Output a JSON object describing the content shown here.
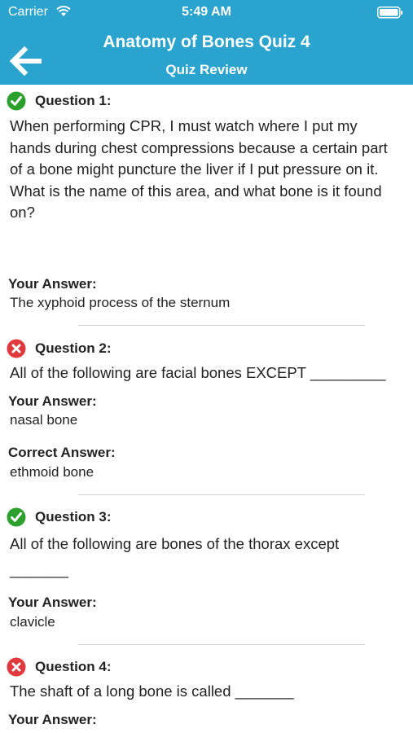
{
  "status_bar": {
    "carrier": "Carrier",
    "time": "5:49 AM"
  },
  "header": {
    "title": "Anatomy of Bones Quiz 4",
    "subtitle": "Quiz Review",
    "color": "#2aa3cf"
  },
  "colors": {
    "correct": "#2ca02c",
    "incorrect": "#e0393e"
  },
  "questions": [
    {
      "label": "Question 1:",
      "status": "correct",
      "text": "When performing CPR, I must watch where I put my hands during chest compressions because a certain part of a bone might puncture the liver if I put pressure on it. What is the name of this area, and what bone is it found on?",
      "your_answer_label": "Your Answer:",
      "your_answer": "The xyphoid process of the sternum"
    },
    {
      "label": "Question 2:",
      "status": "incorrect",
      "text": "All of the following are facial bones EXCEPT _________",
      "your_answer_label": "Your Answer:",
      "your_answer": "nasal bone",
      "correct_answer_label": "Correct Answer:",
      "correct_answer": "ethmoid bone"
    },
    {
      "label": "Question 3:",
      "status": "correct",
      "text": "All of the following are bones of the thorax except _______",
      "your_answer_label": "Your Answer:",
      "your_answer": "clavicle"
    },
    {
      "label": "Question 4:",
      "status": "incorrect",
      "text": "The shaft of a long bone is called _______",
      "your_answer_label": "Your Answer:"
    }
  ]
}
